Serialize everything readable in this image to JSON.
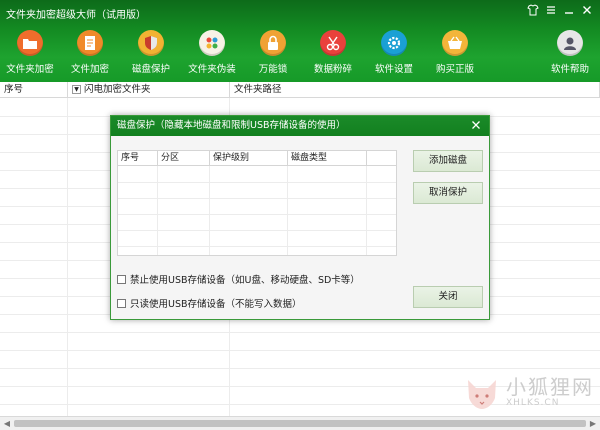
{
  "window": {
    "title": "文件夹加密超级大师（试用版）",
    "controls": [
      "shirt-icon",
      "menu-icon",
      "minimize-icon",
      "close-icon"
    ]
  },
  "toolbar": {
    "items": [
      {
        "label": "文件夹加密",
        "icon": "folder-lock-icon",
        "color": "#ef6d2c"
      },
      {
        "label": "文件加密",
        "icon": "file-lock-icon",
        "color": "#f08a2a"
      },
      {
        "label": "磁盘保护",
        "icon": "shield-icon",
        "color": "#f2b233"
      },
      {
        "label": "文件夹伪装",
        "icon": "disguise-icon",
        "color": "#f7f2e6"
      },
      {
        "label": "万能锁",
        "icon": "padlock-icon",
        "color": "#f0a234"
      },
      {
        "label": "数据粉碎",
        "icon": "shredder-icon",
        "color": "#e9413c"
      },
      {
        "label": "软件设置",
        "icon": "settings-icon",
        "color": "#1aa0d4"
      },
      {
        "label": "购买正版",
        "icon": "cart-icon",
        "color": "#f3b53a"
      },
      {
        "label": "软件帮助",
        "icon": "help-avatar-icon",
        "color": "#e6e6e6"
      }
    ]
  },
  "list": {
    "columns": [
      "序号",
      "闪电加密文件夹",
      "文件夹路径"
    ]
  },
  "dialog": {
    "title": "磁盘保护（隐藏本地磁盘和限制USB存储设备的使用）",
    "grid_columns": [
      "序号",
      "分区",
      "保护级别",
      "磁盘类型"
    ],
    "buttons": {
      "add": "添加磁盘",
      "cancel": "取消保护",
      "close": "关闭"
    },
    "options": [
      {
        "label": "禁止使用USB存储设备（如U盘、移动硬盘、SD卡等）",
        "checked": false
      },
      {
        "label": "只读使用USB存储设备（不能写入数据）",
        "checked": false
      }
    ]
  },
  "watermark": {
    "cn": "小狐狸网",
    "en": "XHLKS.CN"
  }
}
